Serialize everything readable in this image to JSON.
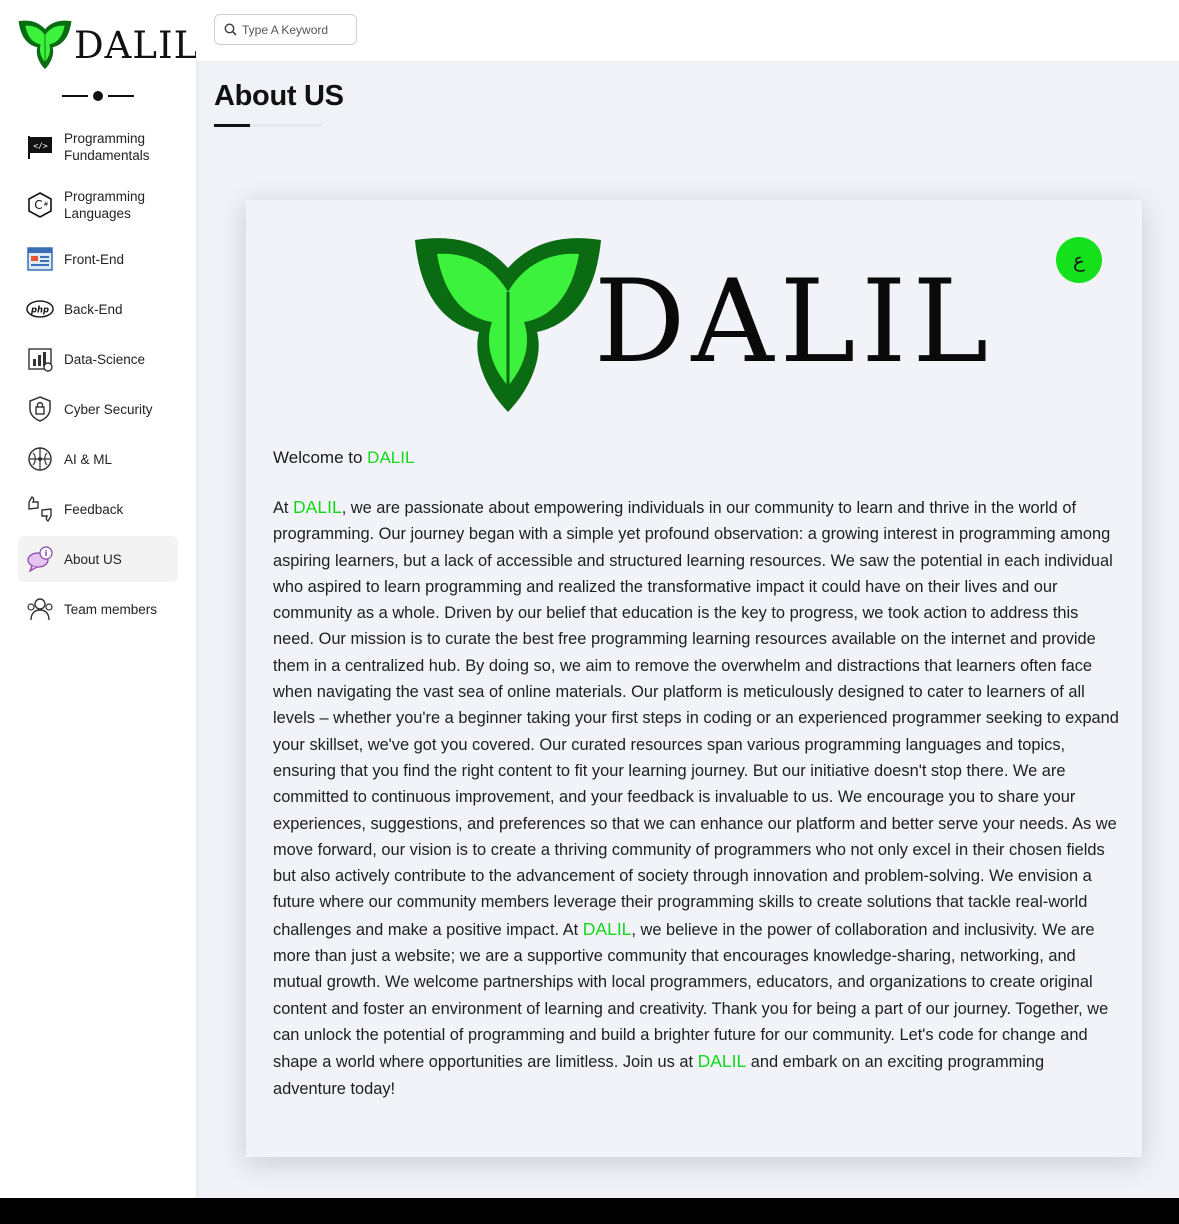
{
  "brand": {
    "logo_text": "DALIL",
    "accent": "#12d81a",
    "logo_dark_green": "#0b6b12",
    "logo_light_green": "#3cf23c"
  },
  "search": {
    "placeholder": "Type A Keyword"
  },
  "sidebar": {
    "items": [
      {
        "label": "Programming Fundamentals",
        "icon": "code-flag-icon"
      },
      {
        "label": "Programming Languages",
        "icon": "csharp-icon"
      },
      {
        "label": "Front-End",
        "icon": "browser-window-icon"
      },
      {
        "label": "Back-End",
        "icon": "php-icon"
      },
      {
        "label": "Data-Science",
        "icon": "data-chart-icon"
      },
      {
        "label": "Cyber Security",
        "icon": "shield-icon"
      },
      {
        "label": "AI & ML",
        "icon": "brain-circuit-icon"
      },
      {
        "label": "Feedback",
        "icon": "thumbs-icon"
      },
      {
        "label": "About US",
        "icon": "info-bubble-icon",
        "active": true
      },
      {
        "label": "Team members",
        "icon": "team-icon"
      }
    ]
  },
  "main": {
    "title": "About US",
    "lang_toggle": "ع",
    "welcome_prefix": "Welcome to ",
    "welcome_brand": "DALIL",
    "paragraph": {
      "p1": "At ",
      "b1": "DALIL",
      "p2": ", we are passionate about empowering individuals in our community to learn and thrive in the world of programming. Our journey began with a simple yet profound observation: a growing interest in programming among aspiring learners, but a lack of accessible and structured learning resources. We saw the potential in each individual who aspired to learn programming and realized the transformative impact it could have on their lives and our community as a whole. Driven by our belief that education is the key to progress, we took action to address this need. Our mission is to curate the best free programming learning resources available on the internet and provide them in a centralized hub. By doing so, we aim to remove the overwhelm and distractions that learners often face when navigating the vast sea of online materials. Our platform is meticulously designed to cater to learners of all levels – whether you're a beginner taking your first steps in coding or an experienced programmer seeking to expand your skillset, we've got you covered. Our curated resources span various programming languages and topics, ensuring that you find the right content to fit your learning journey. But our initiative doesn't stop there. We are committed to continuous improvement, and your feedback is invaluable to us. We encourage you to share your experiences, suggestions, and preferences so that we can enhance our platform and better serve your needs. As we move forward, our vision is to create a thriving community of programmers who not only excel in their chosen fields but also actively contribute to the advancement of society through innovation and problem-solving. We envision a future where our community members leverage their programming skills to create solutions that tackle real-world challenges and make a positive impact. At ",
      "b2": "DALIL",
      "p3": ", we believe in the power of collaboration and inclusivity. We are more than just a website; we are a supportive community that encourages knowledge-sharing, networking, and mutual growth. We welcome partnerships with local programmers, educators, and organizations to create original content and foster an environment of learning and creativity. Thank you for being a part of our journey. Together, we can unlock the potential of programming and build a brighter future for our community. Let's code for change and shape a world where opportunities are limitless. Join us at ",
      "b3": "DALIL",
      "p4": " and embark on an exciting programming adventure today!"
    }
  }
}
